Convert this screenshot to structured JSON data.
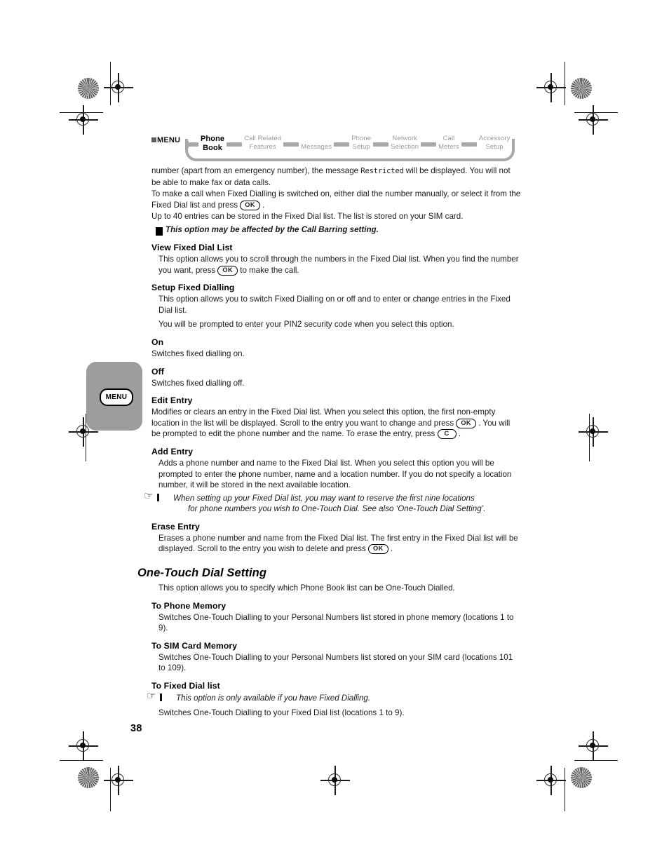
{
  "page": {
    "number": "38"
  },
  "sidebar_tab": {
    "label": "MENU",
    "icon": "menu-button-icon",
    "bg_color": "#9d9d9d"
  },
  "breadcrumb": {
    "root_label": "MENU",
    "active_color": "#000000",
    "inactive_color": "#9a9a9a",
    "items": [
      {
        "label": "Phone\nBook",
        "line1": "Phone",
        "line2": "Book",
        "active": true
      },
      {
        "label": "Call Related Features",
        "line1": "Call Related",
        "line2": "Features",
        "active": false
      },
      {
        "label": "Messages",
        "line1": "Messages",
        "line2": "",
        "active": false
      },
      {
        "label": "Phone Setup",
        "line1": "Phone",
        "line2": "Setup",
        "active": false
      },
      {
        "label": "Network Selection",
        "line1": "Network",
        "line2": "Selection",
        "active": false
      },
      {
        "label": "Call Meters",
        "line1": "Call",
        "line2": "Meters",
        "active": false
      },
      {
        "label": "Accessory Setup",
        "line1": "Accessory",
        "line2": "Setup",
        "active": false
      }
    ]
  },
  "content": {
    "intro_para_1_a": "number (apart from an emergency number), the message ",
    "intro_para_1_lcd": "Restricted",
    "intro_para_1_b": " will be displayed. You will not be able to make fax or data calls.",
    "intro_para_2_a": "To make a call when Fixed Dialling is switched on, either dial the number manually, or select it from the Fixed Dial list and press ",
    "intro_para_2_key": "OK",
    "intro_para_2_b": " .",
    "intro_para_3": "Up to 40 entries can be stored in the Fixed Dial list. The list is stored on your SIM card.",
    "warning_note": "This option may be affected by the Call Barring setting.",
    "sections": [
      {
        "heading": "View Fixed Dial List",
        "body_a": "This option allows you to scroll through the numbers in the Fixed Dial list. When you find the number you want, press ",
        "key": "OK",
        "body_b": " to make the call."
      },
      {
        "heading": "Setup Fixed Dialling",
        "body_1": "This option allows you to switch Fixed Dialling on or off and to enter or change entries in the Fixed Dial list.",
        "body_2": "You will be prompted to enter your PIN2 security code when you select this option."
      },
      {
        "heading": "On",
        "body": "Switches fixed dialling on."
      },
      {
        "heading": "Off",
        "body": "Switches fixed dialling off."
      },
      {
        "heading": "Edit Entry",
        "body_a": "Modifies or clears an entry in the Fixed Dial list. When you select this option, the first non-empty location in the list will be displayed. Scroll to the entry you want to change and press ",
        "key1": "OK",
        "body_b": " . You will be prompted to edit the phone number and the name. To erase the entry, press ",
        "key2": "C",
        "body_c": " ."
      },
      {
        "heading": "Add Entry",
        "body": "Adds a phone number and name to the Fixed Dial list. When you select this option you will be prompted to enter the phone number, name and a location number. If you do not specify a location number, it will be stored in the next available location.",
        "note_line1": "When setting up your Fixed Dial list, you may want to reserve the first nine locations",
        "note_line2": "for phone numbers you wish to One-Touch Dial. See also ‘One-Touch Dial Setting’."
      },
      {
        "heading": "Erase Entry",
        "body_a": "Erases a phone number and name from the Fixed Dial list. The first entry in the Fixed Dial list will be displayed. Scroll to the entry you wish to delete and press ",
        "key": "OK",
        "body_b": " ."
      }
    ],
    "main_heading": "One-Touch Dial Setting",
    "main_heading_body": "This option allows you to specify which Phone Book list can be One-Touch Dialled.",
    "sections_2": [
      {
        "heading": "To Phone Memory",
        "body": "Switches One-Touch Dialling to your Personal Numbers list stored in phone memory (locations 1 to 9)."
      },
      {
        "heading": "To SIM Card Memory",
        "body": "Switches One-Touch Dialling to your Personal Numbers list stored on your SIM card (locations 101 to 109)."
      },
      {
        "heading": "To Fixed Dial list",
        "note": "This option is only available if you have Fixed Dialling.",
        "body": "Switches One-Touch Dialling to your Fixed Dial list (locations 1 to 9)."
      }
    ]
  }
}
